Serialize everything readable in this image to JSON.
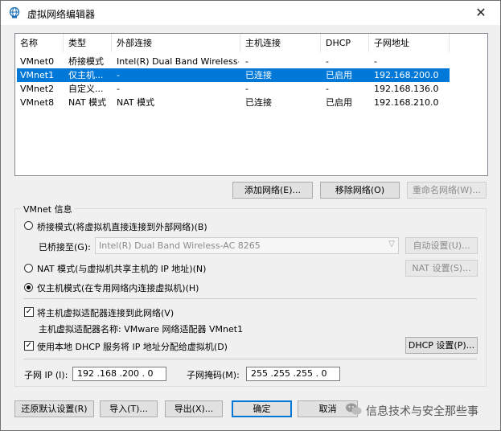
{
  "window": {
    "title": "虚拟网络编辑器",
    "close_label": "✕"
  },
  "list": {
    "headers": [
      "名称",
      "类型",
      "外部连接",
      "主机连接",
      "DHCP",
      "子网地址"
    ],
    "rows": [
      {
        "name": "VMnet0",
        "type": "桥接模式",
        "external": "Intel(R) Dual Band Wireless-...",
        "host": "-",
        "dhcp": "-",
        "subnet": "-",
        "selected": false
      },
      {
        "name": "VMnet1",
        "type": "仅主机...",
        "external": "-",
        "host": "已连接",
        "dhcp": "已启用",
        "subnet": "192.168.200.0",
        "selected": true
      },
      {
        "name": "VMnet2",
        "type": "自定义...",
        "external": "-",
        "host": "-",
        "dhcp": "-",
        "subnet": "192.168.136.0",
        "selected": false
      },
      {
        "name": "VMnet8",
        "type": "NAT 模式",
        "external": "NAT 模式",
        "host": "已连接",
        "dhcp": "已启用",
        "subnet": "192.168.210.0",
        "selected": false
      }
    ]
  },
  "list_buttons": {
    "add": "添加网络(E)...",
    "remove": "移除网络(O)",
    "rename": "重命名网络(W)..."
  },
  "vmnet_info": {
    "group_label": "VMnet 信息",
    "bridged_label": "桥接模式(将虚拟机直接连接到外部网络)(B)",
    "bridged_to_label": "已桥接至(G):",
    "bridged_to_value": "Intel(R) Dual Band Wireless-AC 8265",
    "auto_settings": "自动设置(U)...",
    "nat_label": "NAT 模式(与虚拟机共享主机的 IP 地址)(N)",
    "nat_settings": "NAT 设置(S)...",
    "hostonly_label": "仅主机模式(在专用网络内连接虚拟机)(H)",
    "selected_mode": "hostonly",
    "connect_adapter_label": "将主机虚拟适配器连接到此网络(V)",
    "connect_adapter_checked": true,
    "adapter_name_label": "主机虚拟适配器名称: VMware 网络适配器 VMnet1",
    "use_dhcp_label": "使用本地 DHCP 服务将 IP 地址分配给虚拟机(D)",
    "use_dhcp_checked": true,
    "dhcp_settings": "DHCP 设置(P)...",
    "subnet_ip_label": "子网 IP (I):",
    "subnet_ip_value": "192 .168 .200 . 0",
    "subnet_mask_label": "子网掩码(M):",
    "subnet_mask_value": "255 .255 .255 . 0"
  },
  "footer": {
    "restore": "还原默认设置(R)",
    "import": "导入(T)...",
    "export": "导出(X)...",
    "ok": "确定",
    "cancel": "取消",
    "watermark": "信息技术与安全那些事"
  },
  "colors": {
    "selection": "#0078d7",
    "title_bg": "#ffffff",
    "dialog_bg": "#f0f0f0"
  }
}
